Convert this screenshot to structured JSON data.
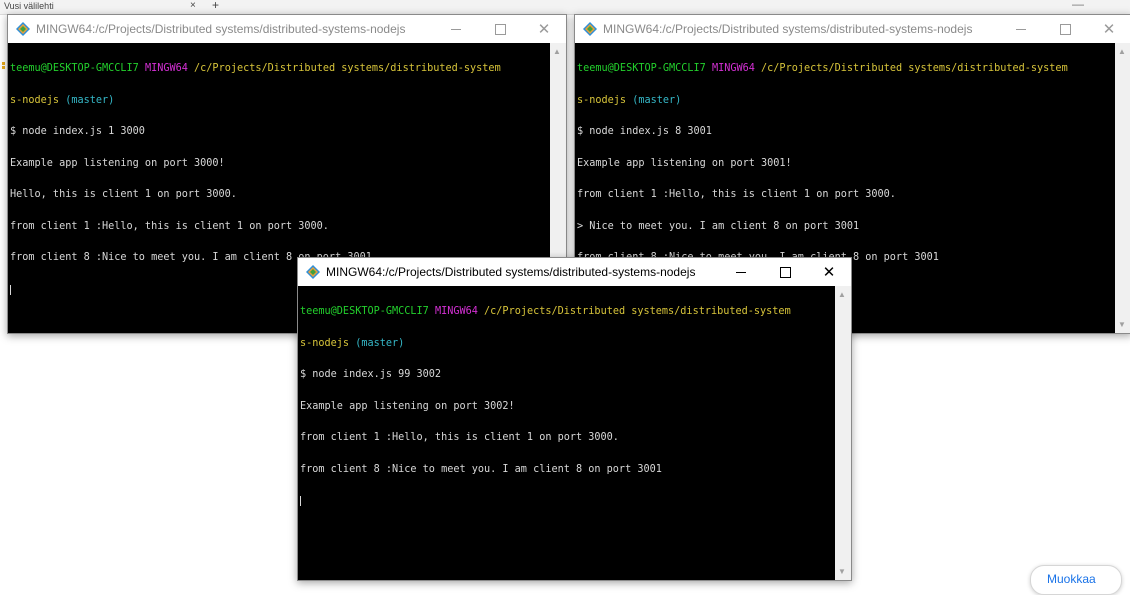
{
  "browser": {
    "tab_label": "Vusi välilehti",
    "tab_close": "×",
    "tab_new": "+",
    "window_controls": "— "
  },
  "windows": [
    {
      "title": "MINGW64:/c/Projects/Distributed systems/distributed-systems-nodejs",
      "lines": [
        "teemu@DESKTOP-GMCCLI7 MINGW64 /c/Projects/Distributed systems/distributed-system",
        "s-nodejs (master)",
        "$ node index.js 1 3000",
        "Example app listening on port 3000!",
        "Hello, this is client 1 on port 3000.",
        "from client 1 :Hello, this is client 1 on port 3000.",
        "from client 8 :Nice to meet you. I am client 8 on port 3001"
      ]
    },
    {
      "title": "MINGW64:/c/Projects/Distributed systems/distributed-systems-nodejs",
      "lines": [
        "teemu@DESKTOP-GMCCLI7 MINGW64 /c/Projects/Distributed systems/distributed-system",
        "s-nodejs (master)",
        "$ node index.js 8 3001",
        "Example app listening on port 3001!",
        "from client 1 :Hello, this is client 1 on port 3000.",
        "> Nice to meet you. I am client 8 on port 3001",
        "from client 8 :Nice to meet you. I am client 8 on port 3001"
      ]
    },
    {
      "title": "MINGW64:/c/Projects/Distributed systems/distributed-systems-nodejs",
      "lines": [
        "teemu@DESKTOP-GMCCLI7 MINGW64 /c/Projects/Distributed systems/distributed-system",
        "s-nodejs (master)",
        "$ node index.js 99 3002",
        "Example app listening on port 3002!",
        "from client 1 :Hello, this is client 1 on port 3000.",
        "from client 8 :Nice to meet you. I am client 8 on port 3001"
      ]
    }
  ],
  "prompt_parts": {
    "userhost": "teemu@DESKTOP-GMCCLI7",
    "shell": "MINGW64",
    "path": "/c/Projects/Distributed systems/distributed-system",
    "path_cont": "s-nodejs",
    "branch": "(master)"
  },
  "bottom_pill": "Muokkaa",
  "colors": {
    "prompt_user": "#23d12d",
    "prompt_shell": "#d530d5",
    "prompt_path": "#d7c43a",
    "prompt_branch": "#35b8c8",
    "terminal_bg": "#000000",
    "terminal_text": "#d8d8d8"
  },
  "icons": {
    "window": "git-bash-icon",
    "minimize": "minimize-icon",
    "maximize": "maximize-icon",
    "close": "close-icon"
  }
}
